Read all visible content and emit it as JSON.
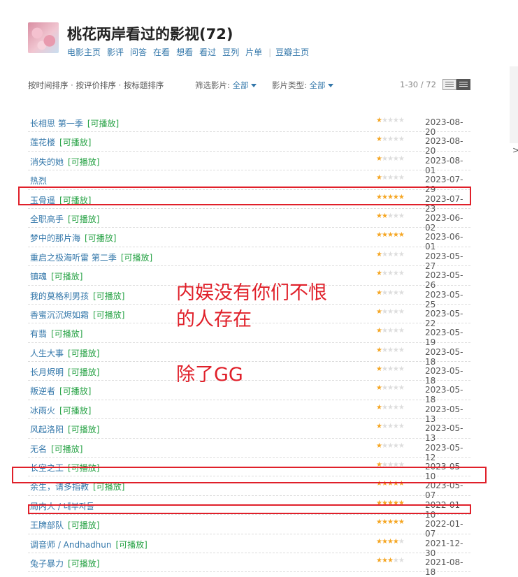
{
  "header": {
    "title": "桃花两岸看过的影视(72)",
    "nav": [
      "电影主页",
      "影评",
      "问答",
      "在看",
      "想看",
      "看过",
      "豆列",
      "片单",
      "豆瓣主页"
    ]
  },
  "filters": {
    "sort_options": [
      "按时间排序",
      "按评价排序",
      "按标题排序"
    ],
    "film_filter_label": "筛选影片:",
    "film_filter_value": "全部",
    "type_filter_label": "影片类型:",
    "type_filter_value": "全部",
    "pagination": "1-30 / 72"
  },
  "playable_tag": "[可播放]",
  "rows": [
    {
      "title": "长相思 第一季",
      "playable": true,
      "rating": 1,
      "date": "2023-08-20"
    },
    {
      "title": "莲花楼",
      "playable": true,
      "rating": 1,
      "date": "2023-08-20"
    },
    {
      "title": "消失的她",
      "playable": true,
      "rating": 1,
      "date": "2023-08-01"
    },
    {
      "title": "热烈",
      "playable": false,
      "rating": 1,
      "date": "2023-07-29"
    },
    {
      "title": "玉骨遥",
      "playable": true,
      "rating": 5,
      "date": "2023-07-23"
    },
    {
      "title": "全职高手",
      "playable": true,
      "rating": 2,
      "date": "2023-06-02"
    },
    {
      "title": "梦中的那片海",
      "playable": true,
      "rating": 5,
      "date": "2023-06-01"
    },
    {
      "title": "重启之极海听雷 第二季",
      "playable": true,
      "rating": 1,
      "date": "2023-05-27"
    },
    {
      "title": "镇魂",
      "playable": true,
      "rating": 1,
      "date": "2023-05-26"
    },
    {
      "title": "我的莫格利男孩",
      "playable": true,
      "rating": 1,
      "date": "2023-05-25"
    },
    {
      "title": "香蜜沉沉烬如霜",
      "playable": true,
      "rating": 1,
      "date": "2023-05-22"
    },
    {
      "title": "有翡",
      "playable": true,
      "rating": 1,
      "date": "2023-05-19"
    },
    {
      "title": "人生大事",
      "playable": true,
      "rating": 1,
      "date": "2023-05-18"
    },
    {
      "title": "长月烬明",
      "playable": true,
      "rating": 1,
      "date": "2023-05-18"
    },
    {
      "title": "叛逆者",
      "playable": true,
      "rating": 1,
      "date": "2023-05-18"
    },
    {
      "title": "冰雨火",
      "playable": true,
      "rating": 1,
      "date": "2023-05-13"
    },
    {
      "title": "风起洛阳",
      "playable": true,
      "rating": 1,
      "date": "2023-05-13"
    },
    {
      "title": "无名",
      "playable": true,
      "rating": 1,
      "date": "2023-05-12"
    },
    {
      "title": "长空之王",
      "playable": true,
      "rating": 1,
      "date": "2023-05-10"
    },
    {
      "title": "余生，请多指教",
      "playable": true,
      "rating": 5,
      "date": "2023-05-07"
    },
    {
      "title": "局内人 / 내부자들",
      "playable": false,
      "rating": 5,
      "date": "2022-01-10"
    },
    {
      "title": "王牌部队",
      "playable": true,
      "rating": 5,
      "date": "2022-01-07"
    },
    {
      "title": "调音师 / Andhadhun",
      "playable": true,
      "rating": 4,
      "date": "2021-12-30"
    },
    {
      "title": "兔子暴力",
      "playable": true,
      "rating": 3,
      "date": "2021-08-18"
    }
  ],
  "annotations": {
    "line1": "内娱没有你们不恨",
    "line2": "的人存在",
    "line3": "除了GG",
    "color": "#e0202a"
  },
  "colors": {
    "link": "#3377aa",
    "playable": "#26a244",
    "star": "#f5a623"
  }
}
